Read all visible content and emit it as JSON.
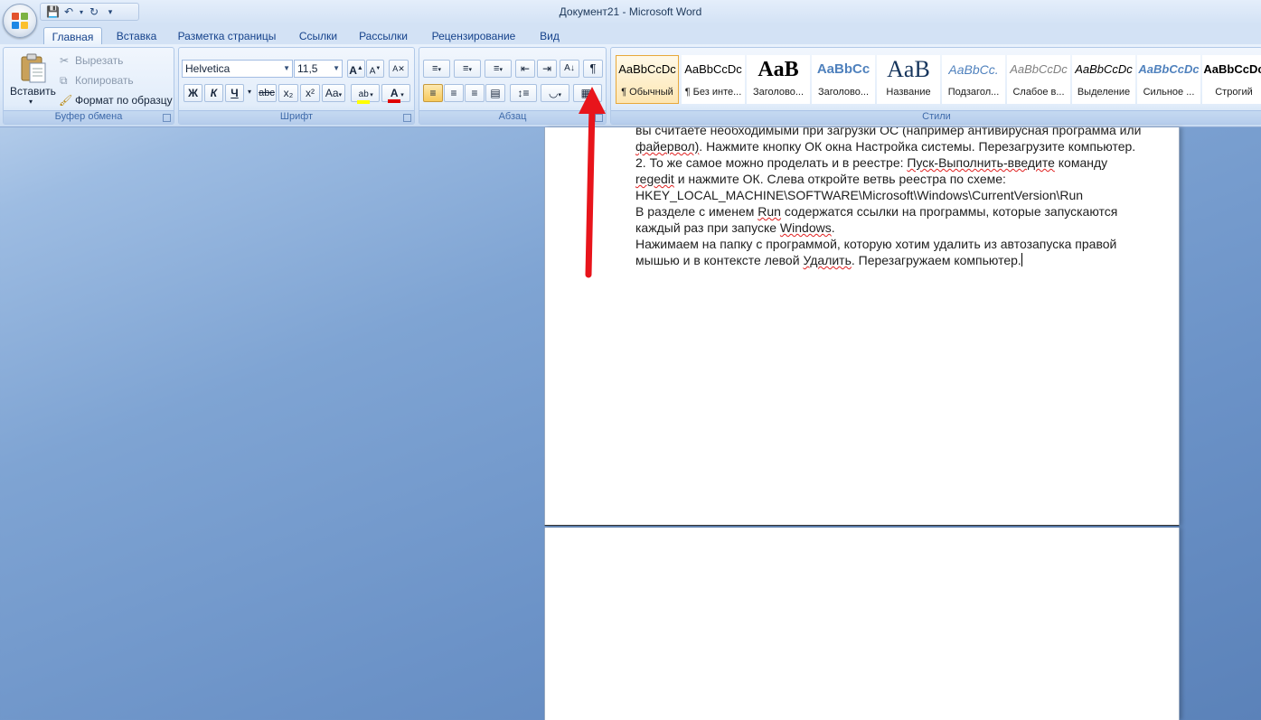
{
  "window": {
    "title": "Документ21 - Microsoft Word"
  },
  "tabs": [
    "Главная",
    "Вставка",
    "Разметка страницы",
    "Ссылки",
    "Рассылки",
    "Рецензирование",
    "Вид"
  ],
  "clipboard": {
    "paste": "Вставить",
    "cut": "Вырезать",
    "copy": "Копировать",
    "format_painter": "Формат по образцу",
    "label": "Буфер обмена"
  },
  "font": {
    "name": "Helvetica",
    "size": "11,5",
    "label": "Шрифт",
    "bold": "Ж",
    "italic": "К",
    "underline": "Ч",
    "strike": "abc",
    "sub": "x₂",
    "sup": "x²",
    "case": "Aa",
    "grow": "A",
    "shrink": "A",
    "text_color_letter": "A"
  },
  "paragraph": {
    "label": "Абзац",
    "pilcrow": "¶"
  },
  "styles": {
    "label": "Стили",
    "items": [
      {
        "sample": "AaBbCcDc",
        "name": "¶ Обычный"
      },
      {
        "sample": "AaBbCcDc",
        "name": "¶ Без инте..."
      },
      {
        "sample": "AaB",
        "name": "Заголово..."
      },
      {
        "sample": "AaBbCc",
        "name": "Заголово..."
      },
      {
        "sample": "AaB",
        "name": "Название"
      },
      {
        "sample": "AaBbCc.",
        "name": "Подзагол..."
      },
      {
        "sample": "AaBbCcDc",
        "name": "Слабое в..."
      },
      {
        "sample": "AaBbCcDc",
        "name": "Выделение"
      },
      {
        "sample": "AaBbCcDc",
        "name": "Сильное ..."
      },
      {
        "sample": "AaBbCcDc",
        "name": "Строгий"
      }
    ]
  },
  "document": {
    "lines": {
      "l0": "вы считаете необходимыми при загрузки ОС (например антивирусная программа или",
      "l1a": "файервол)",
      "l1b": ". Нажмите кнопку ОК окна Настройка системы. Перезагрузите компьютер.",
      "l2a": "2. То же самое можно проделать и в реестре: ",
      "l2b": "Пуск-Выполнить-введите",
      "l2c": " команду",
      "l3a": "regedit",
      "l3b": " и нажмите ОК. Слева откройте ветвь реестра по схеме:",
      "l4": "HKEY_LOCAL_MACHINE\\SOFTWARE\\Microsoft\\Windows\\CurrentVersion\\Run",
      "l5a": "В разделе с именем ",
      "l5b": "Run",
      "l5c": " содержатся ссылки на программы, которые запускаются",
      "l6a": "каждый раз при запуске ",
      "l6b": "Windows",
      "l6c": ".",
      "l7": "Нажимаем на папку с программой, которую хотим удалить из автозапуска правой",
      "l8a": "мышью и в контексте левой ",
      "l8b": "Удалить",
      "l8c": ". Перезагружаем компьютер."
    }
  },
  "colors": {
    "arrow": "#e8141b",
    "highlight": "#ffff00",
    "font_color": "#e00000"
  }
}
